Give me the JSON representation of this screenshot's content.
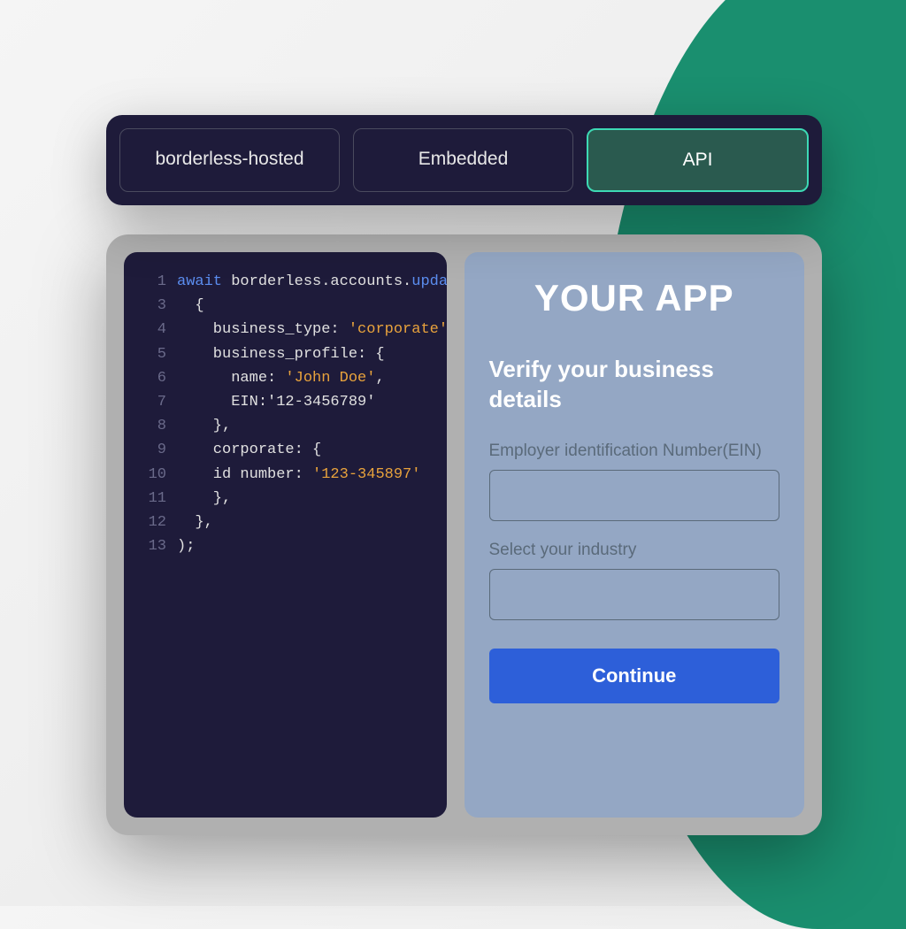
{
  "tabs": {
    "borderless": "borderless-hosted",
    "embedded": "Embedded",
    "api": "API"
  },
  "code": {
    "lines": [
      {
        "num": "1",
        "segments": [
          {
            "t": "await ",
            "c": "kw-await"
          },
          {
            "t": "borderless.accounts."
          },
          {
            "t": "update",
            "c": "kw-method"
          },
          {
            "t": "("
          }
        ]
      },
      {
        "num": "3",
        "segments": [
          {
            "t": "  {"
          }
        ]
      },
      {
        "num": "4",
        "segments": [
          {
            "t": "    business_type: "
          },
          {
            "t": "'corporate'",
            "c": "str-val"
          }
        ]
      },
      {
        "num": "5",
        "segments": [
          {
            "t": "    business_profile: {"
          }
        ]
      },
      {
        "num": "6",
        "segments": [
          {
            "t": "      name: "
          },
          {
            "t": "'John Doe'",
            "c": "str-val"
          },
          {
            "t": ","
          }
        ]
      },
      {
        "num": "7",
        "segments": [
          {
            "t": "      EIN:'12-3456789'"
          }
        ]
      },
      {
        "num": "8",
        "segments": [
          {
            "t": "    },"
          }
        ]
      },
      {
        "num": "9",
        "segments": [
          {
            "t": "    corporate: {"
          }
        ]
      },
      {
        "num": "10",
        "segments": [
          {
            "t": "    id number: "
          },
          {
            "t": "'123-345897'",
            "c": "str-val"
          }
        ]
      },
      {
        "num": "11",
        "segments": [
          {
            "t": "    },"
          }
        ]
      },
      {
        "num": "12",
        "segments": [
          {
            "t": "  },"
          }
        ]
      },
      {
        "num": "13",
        "segments": [
          {
            "t": ");"
          }
        ]
      }
    ]
  },
  "form": {
    "app_title": "YOUR APP",
    "heading": "Verify your business details",
    "ein_label": "Employer identification Number(EIN)",
    "industry_label": "Select your industry",
    "continue_label": "Continue"
  }
}
